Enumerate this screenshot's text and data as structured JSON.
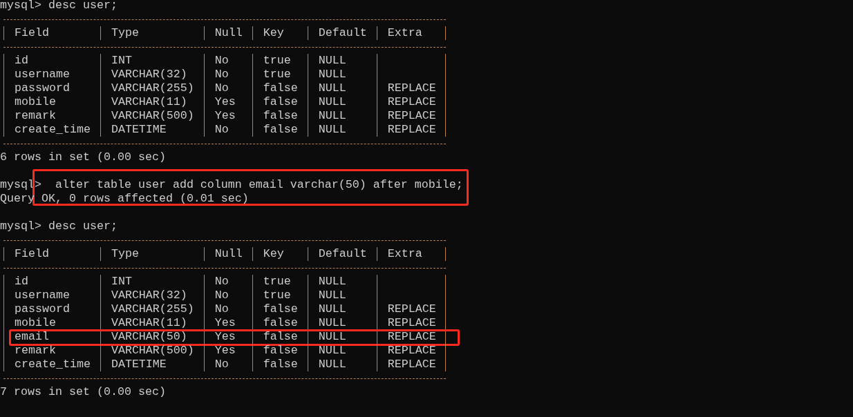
{
  "terminal": {
    "blocks": [
      {
        "kind": "command",
        "prompt": "mysql>",
        "text": "desc user;",
        "highlighted": false
      },
      {
        "kind": "table",
        "columns": [
          "Field",
          "Type",
          "Null",
          "Key",
          "Default",
          "Extra"
        ],
        "rows": [
          {
            "cells": [
              "id",
              "INT",
              "No",
              "true",
              "NULL",
              ""
            ],
            "highlighted": false
          },
          {
            "cells": [
              "username",
              "VARCHAR(32)",
              "No",
              "true",
              "NULL",
              ""
            ],
            "highlighted": false
          },
          {
            "cells": [
              "password",
              "VARCHAR(255)",
              "No",
              "false",
              "NULL",
              "REPLACE"
            ],
            "highlighted": false
          },
          {
            "cells": [
              "mobile",
              "VARCHAR(11)",
              "Yes",
              "false",
              "NULL",
              "REPLACE"
            ],
            "highlighted": false
          },
          {
            "cells": [
              "remark",
              "VARCHAR(500)",
              "Yes",
              "false",
              "NULL",
              "REPLACE"
            ],
            "highlighted": false
          },
          {
            "cells": [
              "create_time",
              "DATETIME",
              "No",
              "false",
              "NULL",
              "REPLACE"
            ],
            "highlighted": false
          }
        ]
      },
      {
        "kind": "output",
        "text": "6 rows in set (0.00 sec)"
      },
      {
        "kind": "command",
        "prompt": "mysql>",
        "text": "alter table user add column email varchar(50) after mobile;",
        "highlighted": true
      },
      {
        "kind": "output",
        "text": "Query OK, 0 rows affected (0.01 sec)"
      },
      {
        "kind": "command",
        "prompt": "mysql>",
        "text": "desc user;",
        "highlighted": false
      },
      {
        "kind": "table",
        "columns": [
          "Field",
          "Type",
          "Null",
          "Key",
          "Default",
          "Extra"
        ],
        "rows": [
          {
            "cells": [
              "id",
              "INT",
              "No",
              "true",
              "NULL",
              ""
            ],
            "highlighted": false
          },
          {
            "cells": [
              "username",
              "VARCHAR(32)",
              "No",
              "true",
              "NULL",
              ""
            ],
            "highlighted": false
          },
          {
            "cells": [
              "password",
              "VARCHAR(255)",
              "No",
              "false",
              "NULL",
              "REPLACE"
            ],
            "highlighted": false
          },
          {
            "cells": [
              "mobile",
              "VARCHAR(11)",
              "Yes",
              "false",
              "NULL",
              "REPLACE"
            ],
            "highlighted": false
          },
          {
            "cells": [
              "email",
              "VARCHAR(50)",
              "Yes",
              "false",
              "NULL",
              "REPLACE"
            ],
            "highlighted": true
          },
          {
            "cells": [
              "remark",
              "VARCHAR(500)",
              "Yes",
              "false",
              "NULL",
              "REPLACE"
            ],
            "highlighted": false
          },
          {
            "cells": [
              "create_time",
              "DATETIME",
              "No",
              "false",
              "NULL",
              "REPLACE"
            ],
            "highlighted": false
          }
        ]
      },
      {
        "kind": "output",
        "text": "7 rows in set (0.00 sec)"
      }
    ]
  }
}
